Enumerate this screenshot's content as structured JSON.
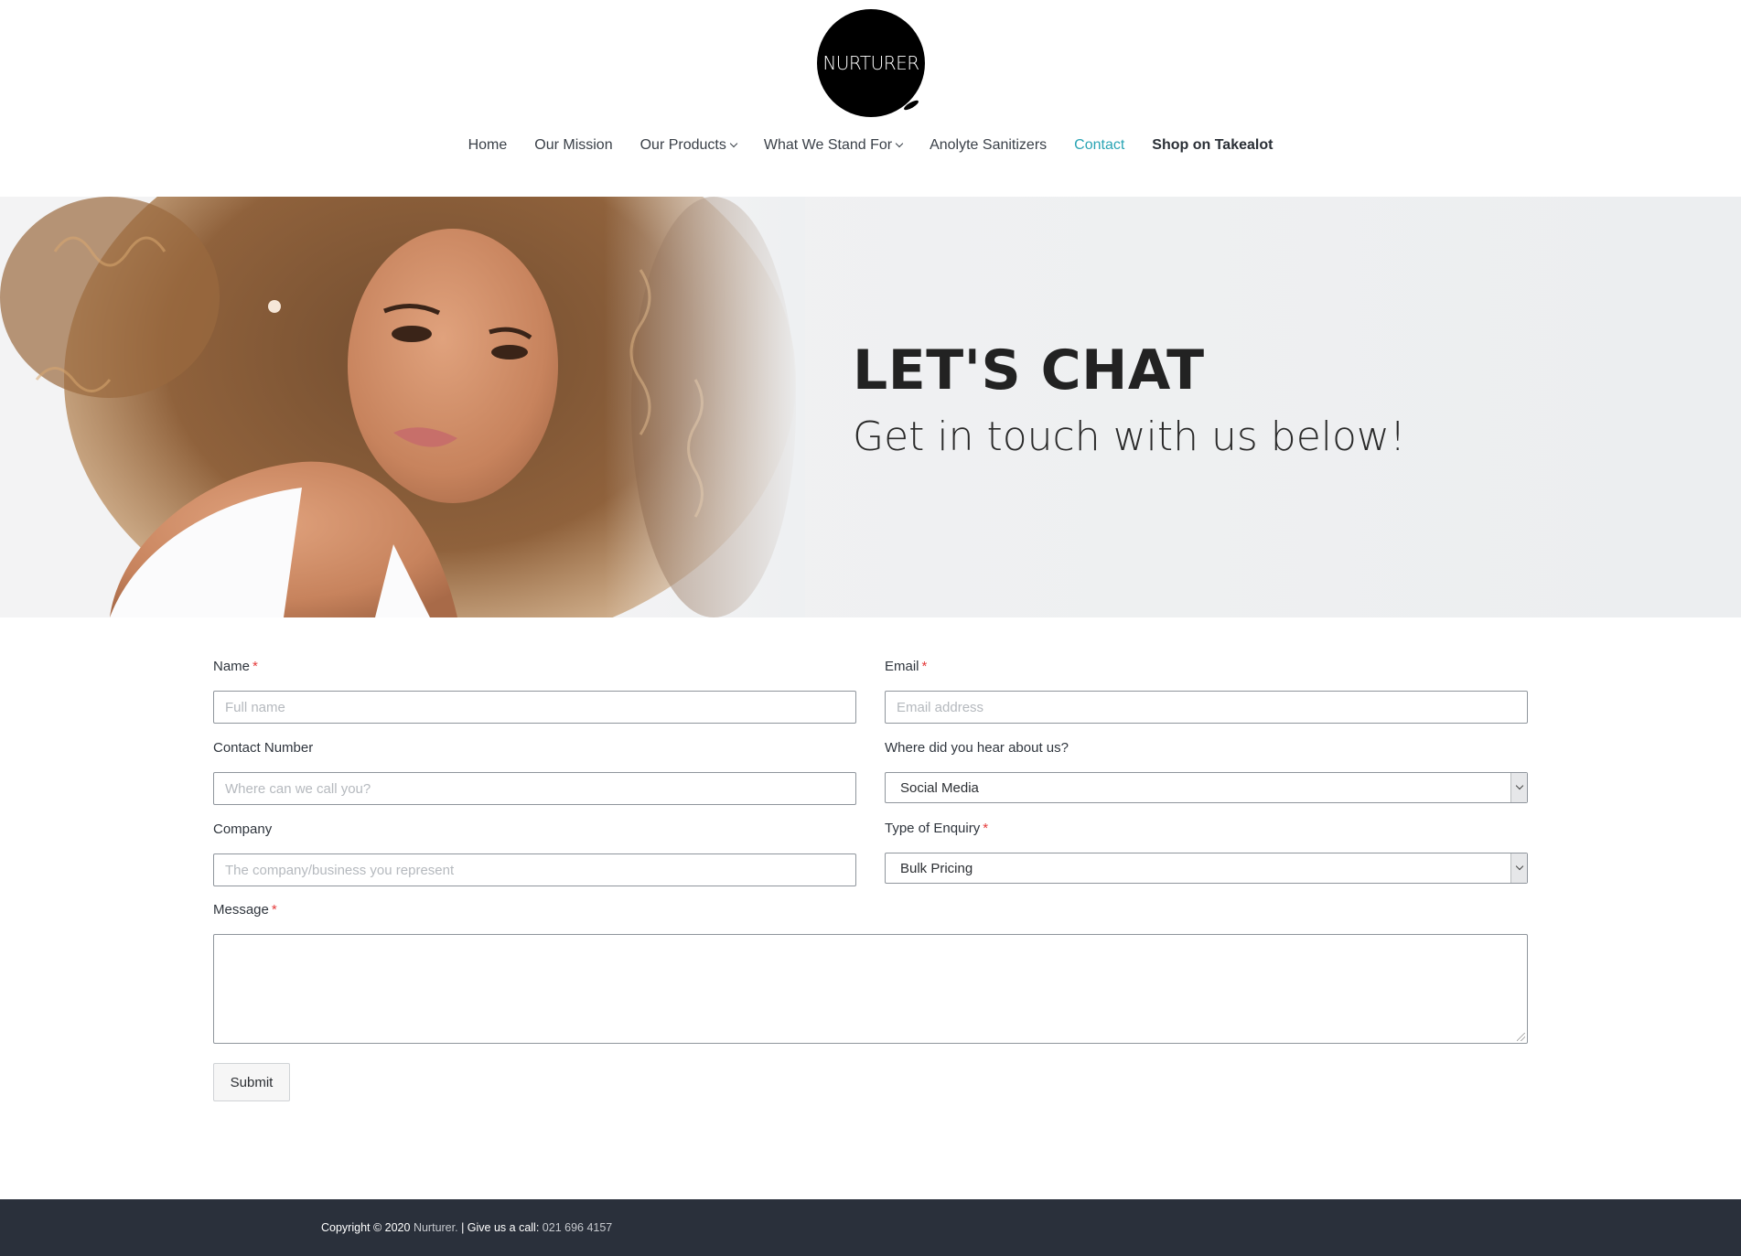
{
  "brand": {
    "logo_text": "NURTURER"
  },
  "nav": {
    "items": [
      {
        "label": "Home"
      },
      {
        "label": "Our Mission"
      },
      {
        "label": "Our Products"
      },
      {
        "label": "What We Stand For"
      },
      {
        "label": "Anolyte Sanitizers"
      },
      {
        "label": "Contact"
      },
      {
        "label": "Shop on Takealot"
      }
    ]
  },
  "hero": {
    "title": "LET'S CHAT",
    "subtitle": "Get in touch with us below!"
  },
  "form": {
    "name": {
      "label": "Name",
      "required_mark": "*",
      "placeholder": "Full name"
    },
    "email": {
      "label": "Email",
      "required_mark": "*",
      "placeholder": "Email address"
    },
    "contact": {
      "label": "Contact Number",
      "placeholder": "Where can we call you?"
    },
    "heard": {
      "label": "Where did you hear about us?",
      "value": "Social Media"
    },
    "company": {
      "label": "Company",
      "placeholder": "The company/business you represent"
    },
    "enquiry": {
      "label": "Type of Enquiry",
      "required_mark": "*",
      "value": "Bulk Pricing"
    },
    "message": {
      "label": "Message",
      "required_mark": "*"
    },
    "submit_label": "Submit"
  },
  "footer": {
    "copyright": "Copyright © 2020",
    "brand": "Nurturer.",
    "call_label": "| Give us a call:",
    "phone": "021 696 4157"
  },
  "colors": {
    "accent": "#29a4b4",
    "required": "#e53b3b",
    "footer_bg": "#2a303b"
  }
}
